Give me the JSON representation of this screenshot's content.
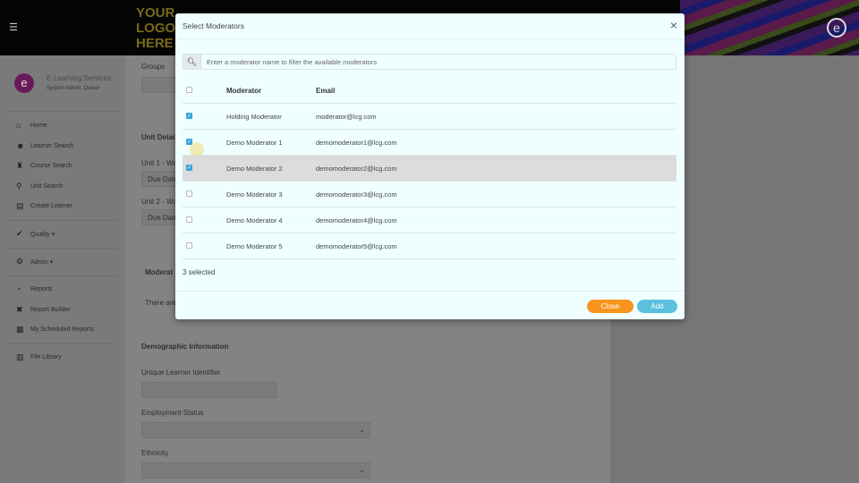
{
  "header": {
    "menu_icon": "hamburger-icon",
    "logo_lines": [
      "YOUR",
      "LOGO",
      "HERE"
    ],
    "brand_icon": "e"
  },
  "sidebar": {
    "org_name": "E-Learning Services",
    "role": "System Admin, Owner",
    "items": [
      {
        "label": "Home",
        "icon": "⌂"
      },
      {
        "label": "Learner Search",
        "icon": "☻"
      },
      {
        "label": "Course Search",
        "icon": "♜"
      },
      {
        "label": "Unit Search",
        "icon": "⚲"
      },
      {
        "label": "Create Learner",
        "icon": "▤"
      },
      {
        "label": "Quality ▾",
        "icon": "✔"
      },
      {
        "label": "Admin ▾",
        "icon": "⚙"
      },
      {
        "label": "Reports",
        "icon": "◔"
      },
      {
        "label": "Report Builder",
        "icon": "✖"
      },
      {
        "label": "My Scheduled Reports",
        "icon": "▦"
      },
      {
        "label": "File Library",
        "icon": "▥"
      }
    ]
  },
  "content": {
    "groups": "Groups",
    "unit_details": "Unit Detai",
    "unit1": "Unit 1 - Wo",
    "unit2": "Unit 2 - Wo",
    "due_date": "Due Date",
    "moderators": "Moderat",
    "there_are": "There are",
    "demographic": "Demographic Information",
    "uli": "Unique Learner Identifier",
    "employment": "Employment Status",
    "ethnicity": "Ethnicity"
  },
  "modal": {
    "title": "Select Moderators",
    "close_icon": "×",
    "search_placeholder": "Enter a moderator name to filter the available moderators",
    "col_moderator": "Moderator",
    "col_email": "Email",
    "rows": [
      {
        "name": "Holding Moderator",
        "email": "moderator@lcg.com",
        "checked": true
      },
      {
        "name": "Demo Moderator 1",
        "email": "demomoderator1@lcg.com",
        "checked": true
      },
      {
        "name": "Demo Moderator 2",
        "email": "demomoderator2@lcg.com",
        "checked": true
      },
      {
        "name": "Demo Moderator 3",
        "email": "demomoderator3@lcg.com",
        "checked": false
      },
      {
        "name": "Demo Moderator 4",
        "email": "demomoderator4@lcg.com",
        "checked": false
      },
      {
        "name": "Demo Moderator 5",
        "email": "demomoderator5@lcg.com",
        "checked": false
      }
    ],
    "selected_text": "3 selected",
    "close_label": "Close",
    "add_label": "Add",
    "colors": {
      "close": "#f7941d",
      "add": "#5bc0de",
      "checkbox": "#3aa6d8"
    }
  }
}
